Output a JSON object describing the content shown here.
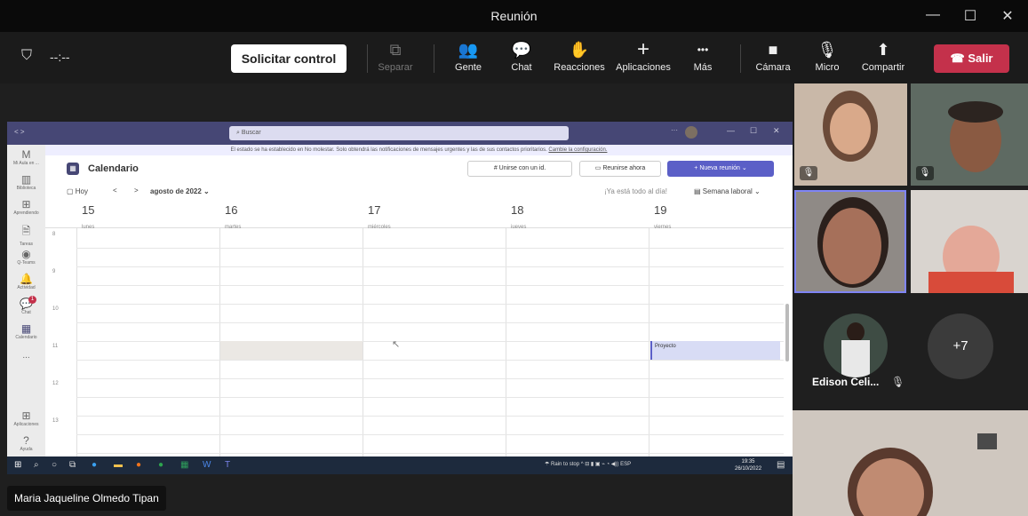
{
  "window": {
    "title": "Reunión",
    "controls": [
      "—",
      "☐",
      "✕"
    ]
  },
  "toolbar": {
    "timer": "--:--",
    "request_control": "Solicitar control",
    "items": [
      {
        "label": "Separar",
        "icon": "⧉",
        "disabled": true
      },
      {
        "label": "Gente",
        "icon": "👥"
      },
      {
        "label": "Chat",
        "icon": "💬"
      },
      {
        "label": "Reacciones",
        "icon": "✋"
      },
      {
        "label": "Aplicaciones",
        "icon": "+"
      },
      {
        "label": "Más",
        "icon": "•••"
      },
      {
        "label": "Cámara",
        "icon": "■"
      },
      {
        "label": "Micro",
        "icon": "🎙"
      },
      {
        "label": "Compartir",
        "icon": "⬆"
      }
    ],
    "leave": "Salir"
  },
  "shared": {
    "search_placeholder": "Buscar",
    "notice": "El estado se ha establecido en No molestar. Solo obtendrá las notificaciones de mensajes urgentes y las de sus contactos prioritarios.",
    "notice_link": "Cambie la configuración.",
    "rail": [
      {
        "label": "Mi Aula en ...",
        "icon": "M"
      },
      {
        "label": "Biblioteca",
        "icon": "▥"
      },
      {
        "label": "Aprendiendo",
        "icon": "⊞"
      },
      {
        "label": "Tareas",
        "icon": "🗎"
      },
      {
        "label": "Q-Teams",
        "icon": "◉"
      },
      {
        "label": "Actividad",
        "icon": "🔔"
      },
      {
        "label": "Chat",
        "icon": "💬"
      },
      {
        "label": "Calendario",
        "icon": "▦"
      },
      {
        "label": "...",
        "icon": ""
      },
      {
        "label": "Aplicaciones",
        "icon": "⊞"
      },
      {
        "label": "Ayuda",
        "icon": "?"
      }
    ],
    "calendar": {
      "title": "Calendario",
      "join_id": "Unirse con un id.",
      "meet_now": "Reunirse ahora",
      "new_meeting": "Nueva reunión",
      "today": "Hoy",
      "month": "agosto de 2022",
      "all_day": "¡Ya está todo al día!",
      "view": "Semana laboral",
      "days": [
        {
          "num": "15",
          "name": "lunes"
        },
        {
          "num": "16",
          "name": "martes"
        },
        {
          "num": "17",
          "name": "miércoles"
        },
        {
          "num": "18",
          "name": "jueves"
        },
        {
          "num": "19",
          "name": "viernes"
        }
      ],
      "hours": [
        "8",
        "9",
        "10",
        "11",
        "12",
        "13"
      ],
      "event": "Proyecto",
      "badge": "1"
    },
    "taskbar": {
      "weather": "Rain to stop",
      "lang": "ESP",
      "time": "19:35",
      "date": "26/10/2022"
    }
  },
  "participants": {
    "named": "Edison Celi...",
    "more": "+7",
    "presenter": "Maria Jaqueline Olmedo Tipan"
  }
}
